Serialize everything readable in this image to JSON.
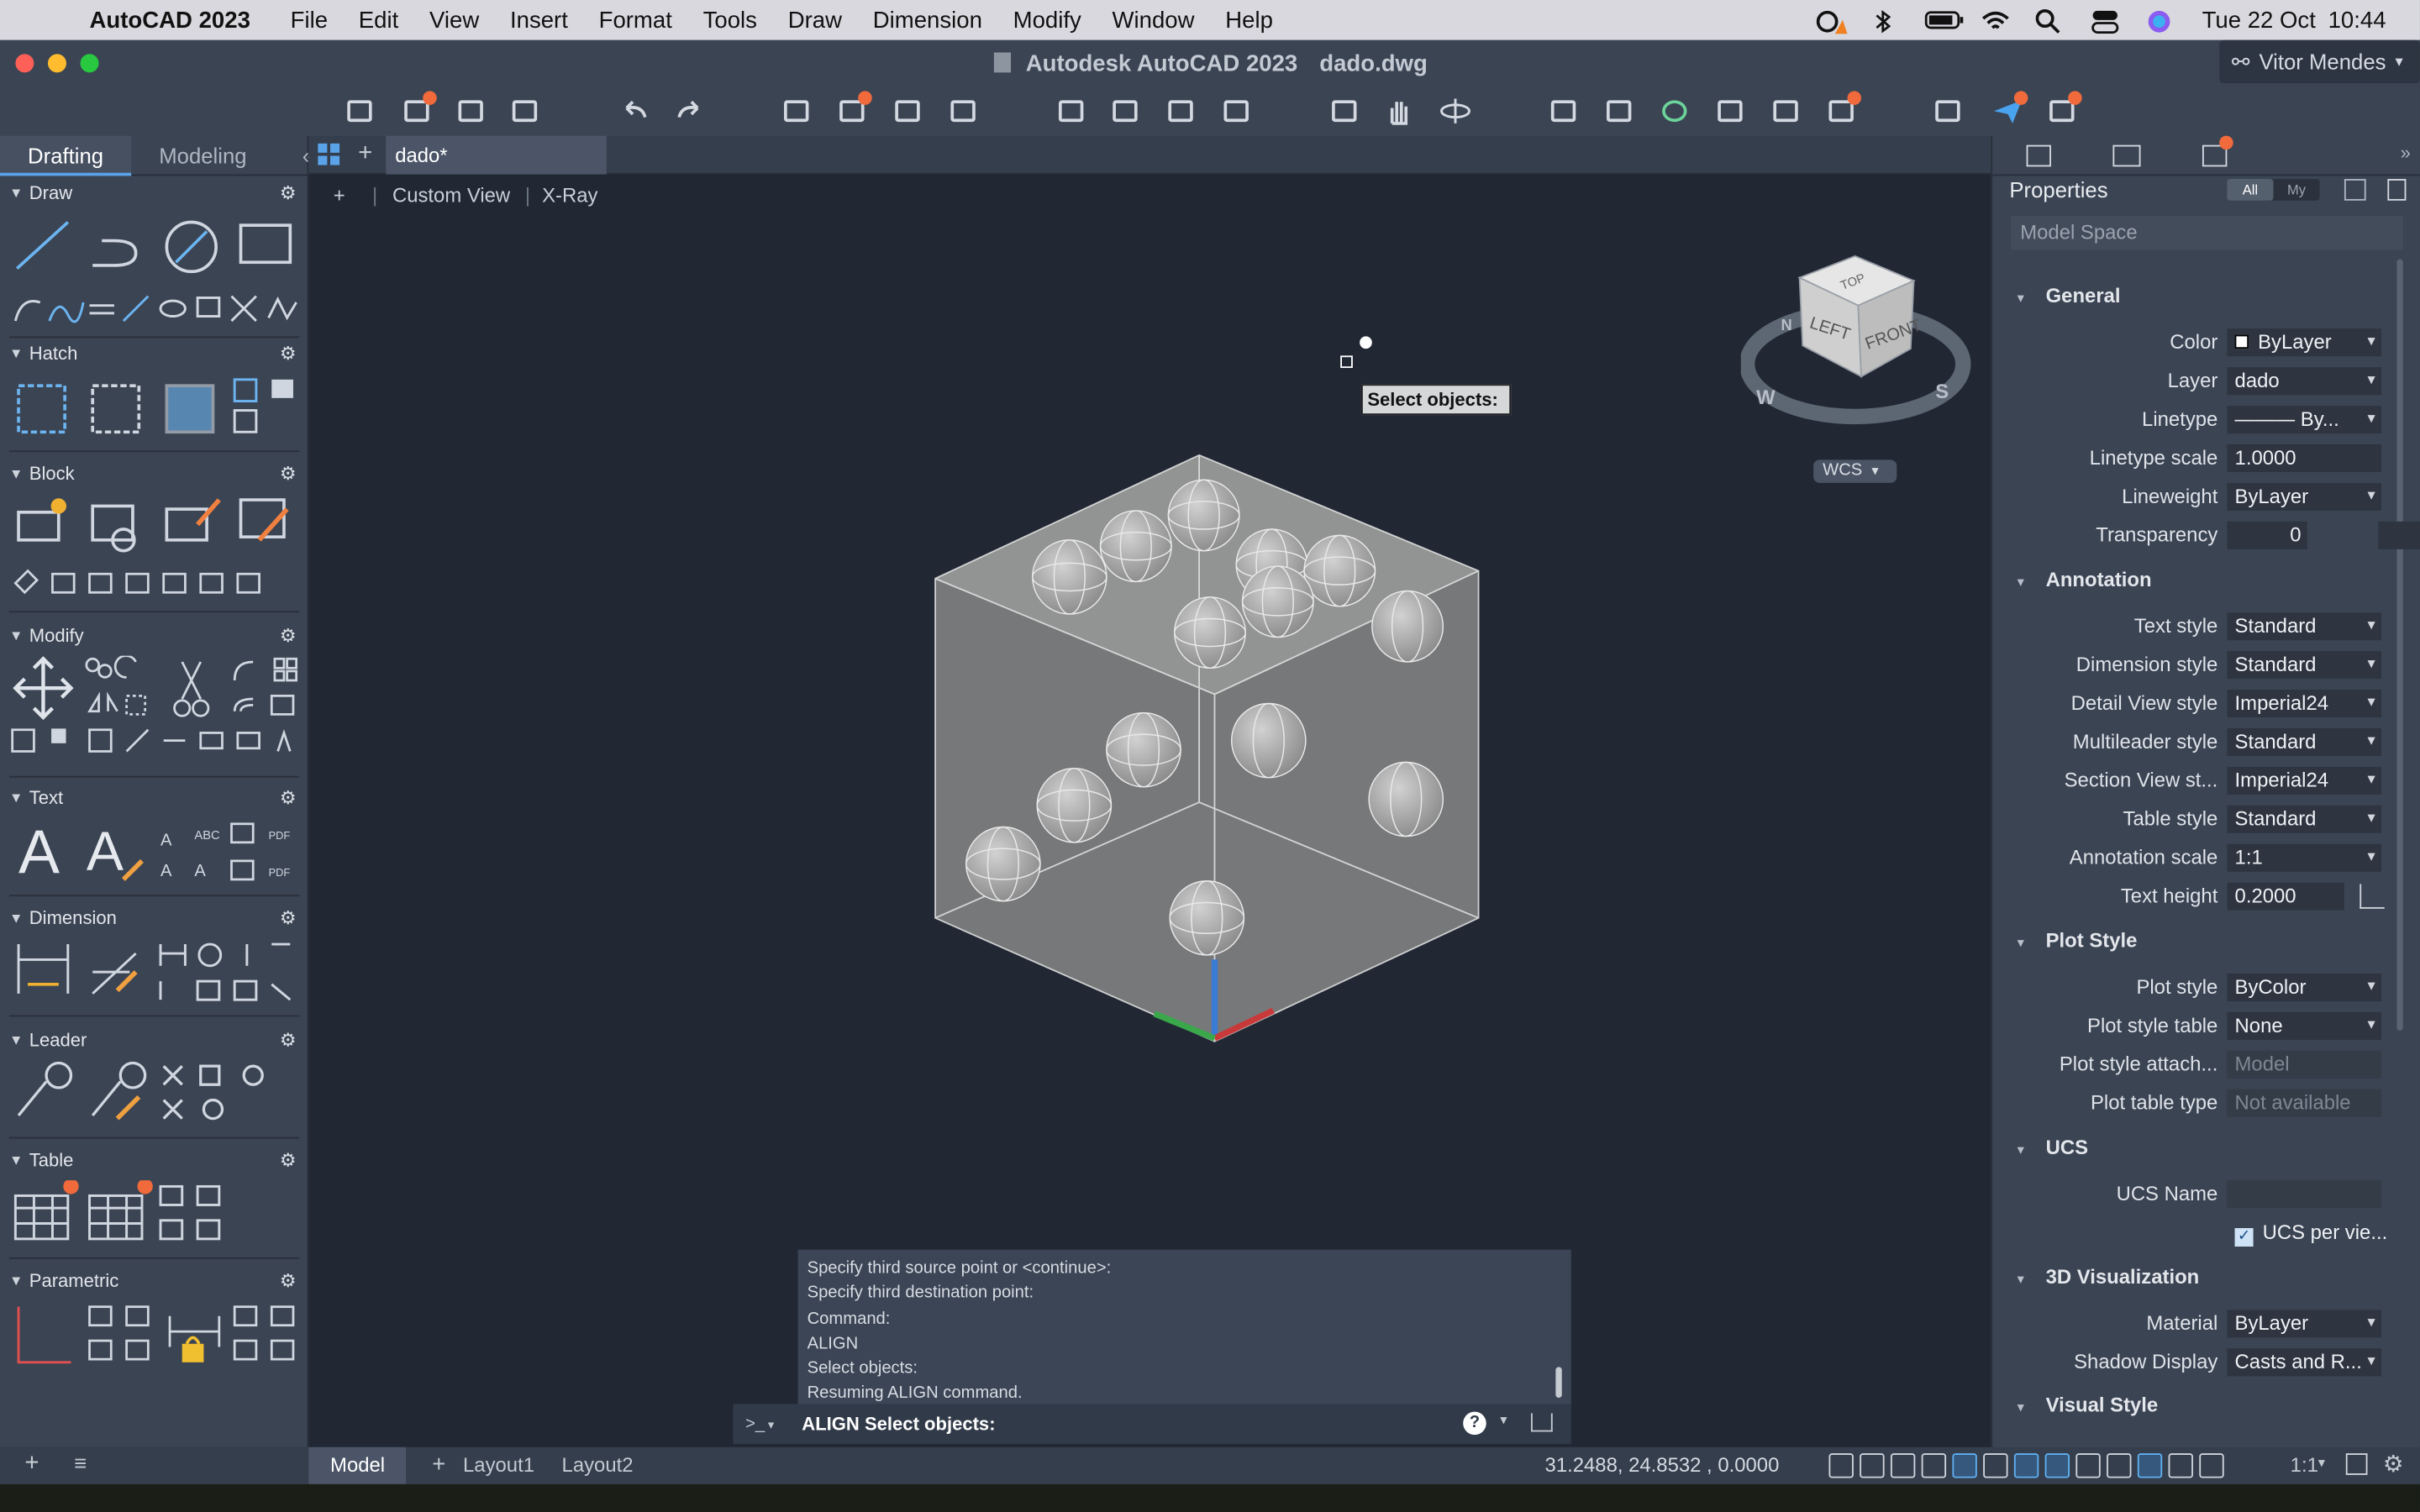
{
  "menubar": {
    "app_name": "AutoCAD 2023",
    "items": [
      "File",
      "Edit",
      "View",
      "Insert",
      "Format",
      "Tools",
      "Draw",
      "Dimension",
      "Modify",
      "Window",
      "Help"
    ],
    "date": "Tue 22 Oct",
    "time": "10:44"
  },
  "window": {
    "app_title": "Autodesk AutoCAD 2023",
    "file_title": "dado.dwg",
    "user": "Vitor Mendes"
  },
  "left_panel": {
    "tabs": [
      "Drafting",
      "Modeling"
    ],
    "active_tab": "Drafting",
    "sections": [
      "Draw",
      "Hatch",
      "Block",
      "Modify",
      "Text",
      "Dimension",
      "Leader",
      "Table",
      "Parametric"
    ]
  },
  "document": {
    "tab": "dado*",
    "view_label": "Custom View",
    "visual_style": "X-Ray",
    "plus": "+"
  },
  "viewcube": {
    "top": "TOP",
    "left": "LEFT",
    "front": "FRONT",
    "n": "N",
    "w": "W",
    "s": "S",
    "wcs": "WCS"
  },
  "tooltip": "Select objects:",
  "command": {
    "history": [
      "Specify third source point or <continue>:",
      "Specify third destination point:",
      "Command:",
      "ALIGN",
      "Select objects:",
      "Resuming ALIGN command."
    ],
    "prompt_symbol": ">_",
    "current": "ALIGN Select objects:"
  },
  "layouts": [
    "Model",
    "Layout1",
    "Layout2"
  ],
  "status": {
    "coords": "31.2488,    24.8532   , 0.0000",
    "scale": "1:1"
  },
  "properties": {
    "title": "Properties",
    "filter_all": "All",
    "filter_my": "My",
    "selection": "Model Space",
    "groups": [
      {
        "name": "General",
        "rows": [
          {
            "label": "Color",
            "value": "ByLayer",
            "type": "dd"
          },
          {
            "label": "Layer",
            "value": "dado",
            "type": "dd"
          },
          {
            "label": "Linetype",
            "value": "——— By...",
            "type": "dd"
          },
          {
            "label": "Linetype scale",
            "value": "1.0000",
            "type": "text"
          },
          {
            "label": "Lineweight",
            "value": "ByLayer",
            "type": "dd"
          },
          {
            "label": "Transparency",
            "value": "0",
            "type": "text"
          }
        ]
      },
      {
        "name": "Annotation",
        "rows": [
          {
            "label": "Text style",
            "value": "Standard",
            "type": "dd"
          },
          {
            "label": "Dimension style",
            "value": "Standard",
            "type": "dd"
          },
          {
            "label": "Detail View style",
            "value": "Imperial24",
            "type": "dd"
          },
          {
            "label": "Multileader style",
            "value": "Standard",
            "type": "dd"
          },
          {
            "label": "Section View st...",
            "value": "Imperial24",
            "type": "dd"
          },
          {
            "label": "Table style",
            "value": "Standard",
            "type": "dd"
          },
          {
            "label": "Annotation scale",
            "value": "1:1",
            "type": "dd"
          },
          {
            "label": "Text height",
            "value": "0.2000",
            "type": "text"
          }
        ]
      },
      {
        "name": "Plot Style",
        "rows": [
          {
            "label": "Plot style",
            "value": "ByColor",
            "type": "dd"
          },
          {
            "label": "Plot style table",
            "value": "None",
            "type": "dd"
          },
          {
            "label": "Plot style attach...",
            "value": "Model",
            "type": "ro"
          },
          {
            "label": "Plot table type",
            "value": "Not available",
            "type": "ro"
          }
        ]
      },
      {
        "name": "UCS",
        "rows": [
          {
            "label": "UCS Name",
            "value": "",
            "type": "ro"
          },
          {
            "label": "",
            "value": "UCS per vie...",
            "type": "check"
          }
        ]
      },
      {
        "name": "3D Visualization",
        "rows": [
          {
            "label": "Material",
            "value": "ByLayer",
            "type": "dd"
          },
          {
            "label": "Shadow Display",
            "value": "Casts and R...",
            "type": "dd"
          }
        ]
      },
      {
        "name": "Visual Style",
        "rows": []
      }
    ]
  },
  "colors": {
    "accent": "#5aa3e8",
    "badge": "#f06a3c",
    "viewport": "#212834",
    "panel": "#3b4453"
  }
}
